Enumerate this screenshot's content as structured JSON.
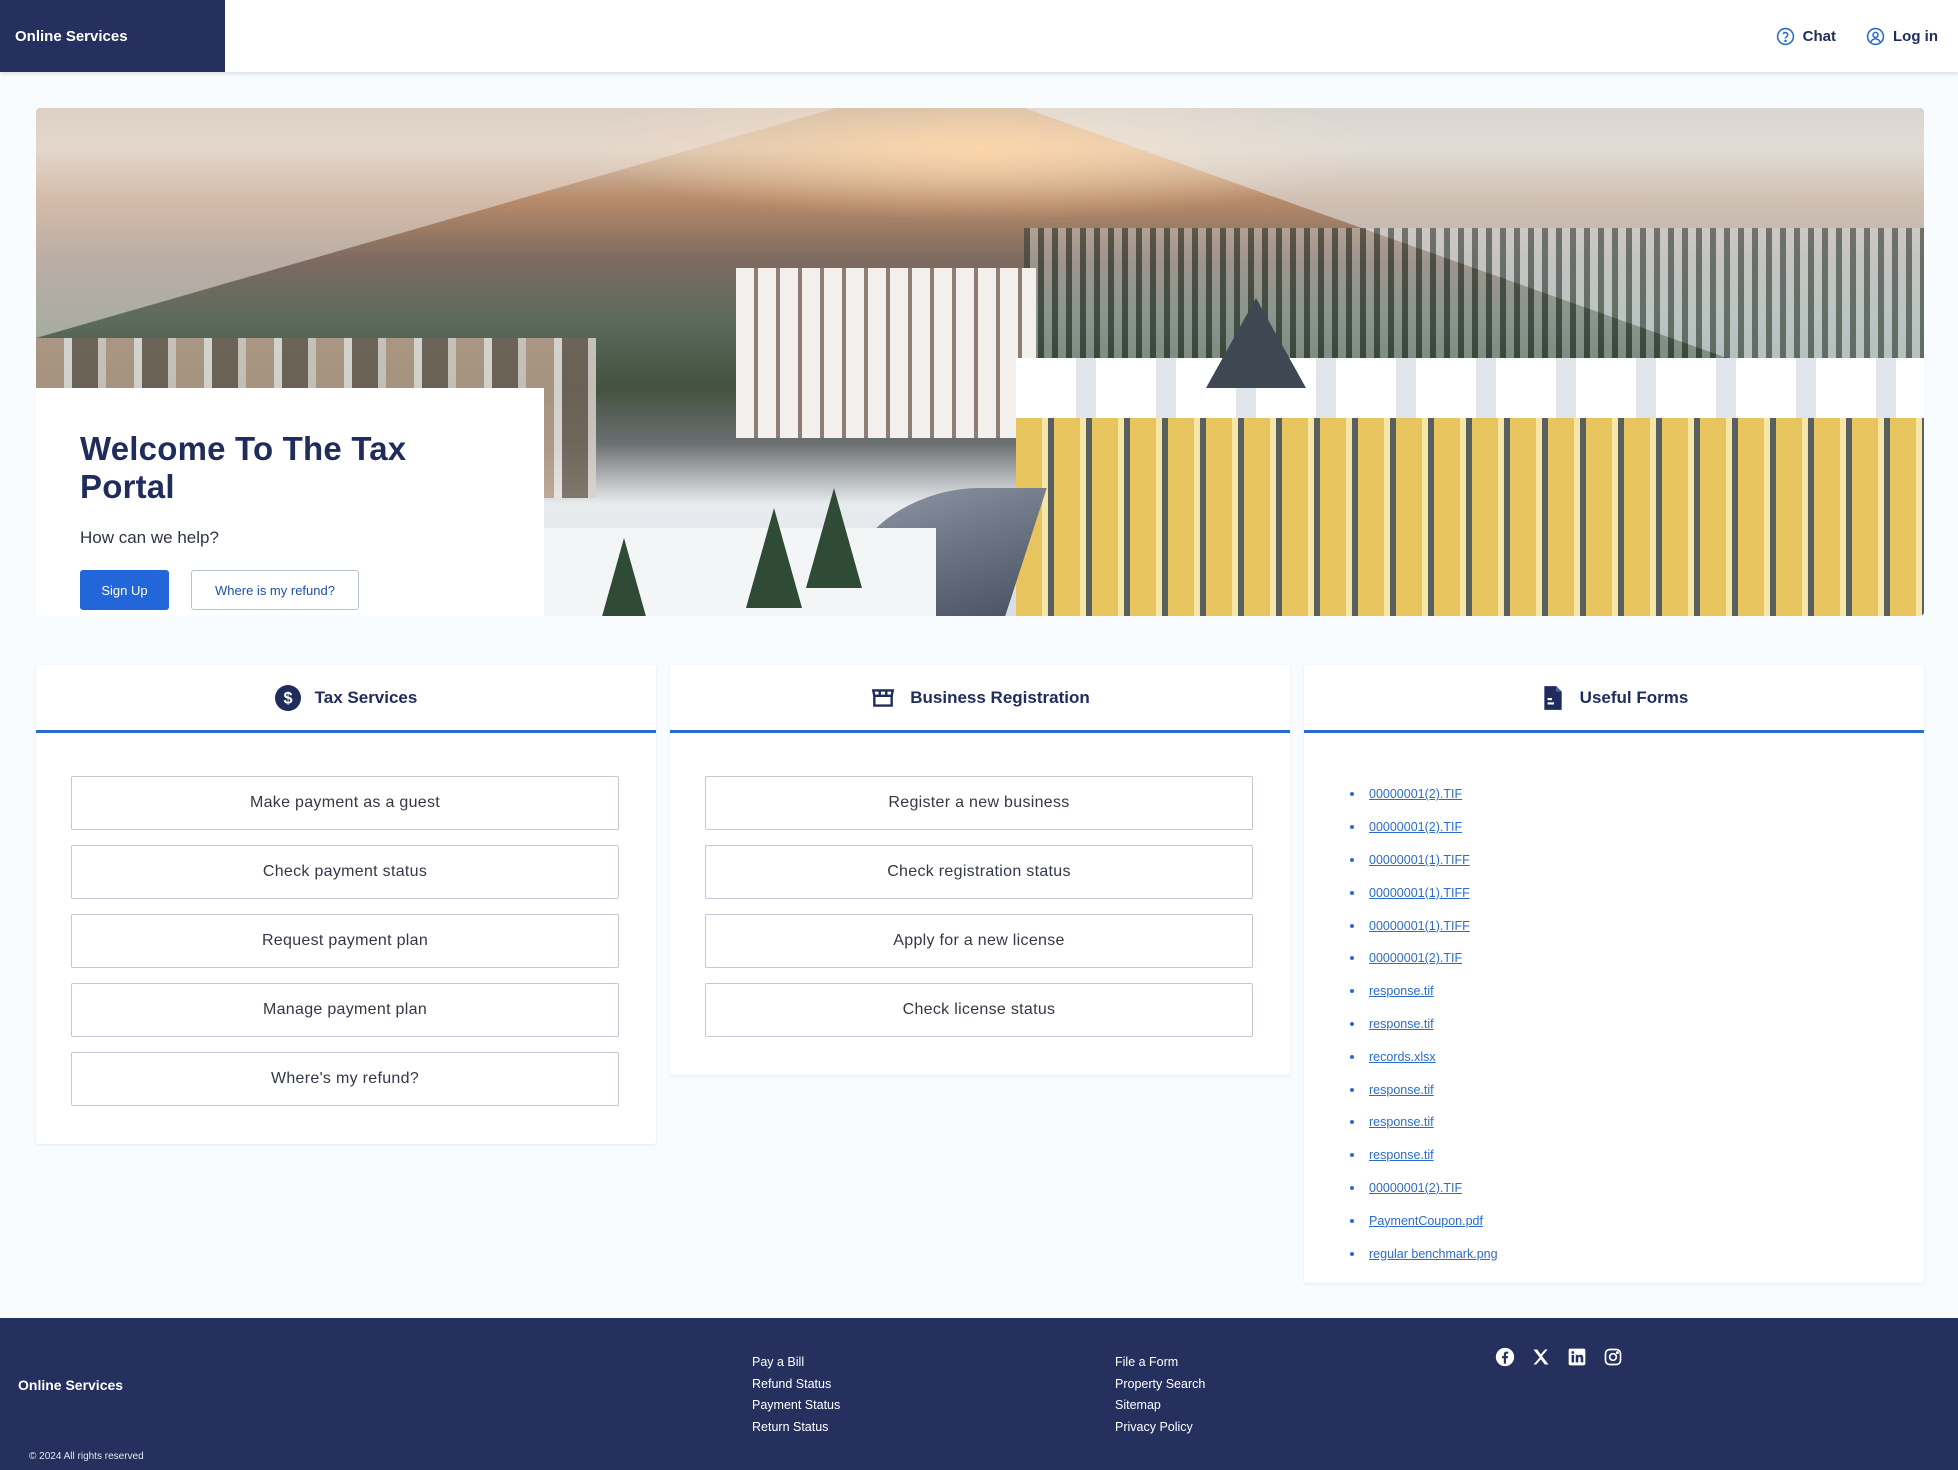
{
  "header": {
    "brand": "Online Services",
    "chat_label": "Chat",
    "login_label": "Log in"
  },
  "hero": {
    "title": "Welcome To The Tax Portal",
    "subtitle": "How can we help?",
    "signup_label": "Sign Up",
    "refund_label": "Where is my refund?"
  },
  "tax_services": {
    "title": "Tax Services",
    "icon": "dollar-icon",
    "items": [
      "Make payment as a guest",
      "Check payment status",
      "Request payment plan",
      "Manage payment plan",
      "Where's my refund?"
    ]
  },
  "business_registration": {
    "title": "Business Registration",
    "icon": "storefront-icon",
    "items": [
      "Register a new business",
      "Check registration status",
      "Apply for a new license",
      "Check license status"
    ]
  },
  "useful_forms": {
    "title": "Useful Forms",
    "icon": "document-icon",
    "files": [
      "00000001(2).TIF",
      "00000001(2).TIF",
      "00000001(1).TIFF",
      "00000001(1).TIFF",
      "00000001(1).TIFF",
      "00000001(2).TIF",
      "response.tif",
      "response.tif",
      "records.xlsx",
      "response.tif",
      "response.tif",
      "response.tif",
      "00000001(2).TIF",
      "PaymentCoupon.pdf",
      "regular benchmark.png"
    ]
  },
  "footer": {
    "brand": "Online Services",
    "copyright": "© 2024 All rights reserved",
    "col1": [
      "Pay a Bill",
      "Refund Status",
      "Payment Status",
      "Return Status"
    ],
    "col2": [
      "File a Form",
      "Property Search",
      "Sitemap",
      "Privacy Policy"
    ],
    "social": [
      "facebook-icon",
      "x-icon",
      "linkedin-icon",
      "instagram-icon"
    ]
  },
  "colors": {
    "navy": "#25305e",
    "primary": "#2266d9",
    "accent": "#2b6ccb",
    "heading": "#1f2c5c"
  }
}
